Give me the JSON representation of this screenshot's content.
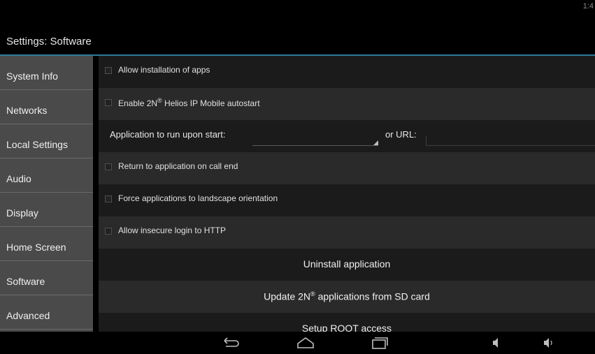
{
  "status": {
    "time": "1:4"
  },
  "header": {
    "title": "Settings: Software"
  },
  "sidebar": {
    "items": [
      {
        "label": "System Info"
      },
      {
        "label": "Networks"
      },
      {
        "label": "Local Settings"
      },
      {
        "label": "Audio"
      },
      {
        "label": "Display"
      },
      {
        "label": "Home Screen"
      },
      {
        "label": "Software"
      },
      {
        "label": "Advanced"
      }
    ]
  },
  "settings": {
    "allow_install": "Allow installation of apps",
    "enable_autostart_pre": "Enable 2N",
    "enable_autostart_sup": "®",
    "enable_autostart_post": " Helios IP Mobile autostart",
    "app_to_run_label": "Application to run upon start:",
    "app_to_run_value": "",
    "url_label": "or URL:",
    "url_value": "",
    "return_on_call_end": "Return to application on call end",
    "force_landscape": "Force applications to landscape orientation",
    "allow_insecure_http": "Allow insecure login to HTTP"
  },
  "actions": {
    "uninstall": "Uninstall application",
    "update_pre": "Update 2N",
    "update_sup": "®",
    "update_post": " applications from SD card",
    "setup_root": "Setup ROOT access"
  },
  "navbar": {
    "icons": [
      "back-icon",
      "home-icon",
      "recent-apps-icon",
      "volume-down-icon",
      "volume-up-icon"
    ]
  }
}
